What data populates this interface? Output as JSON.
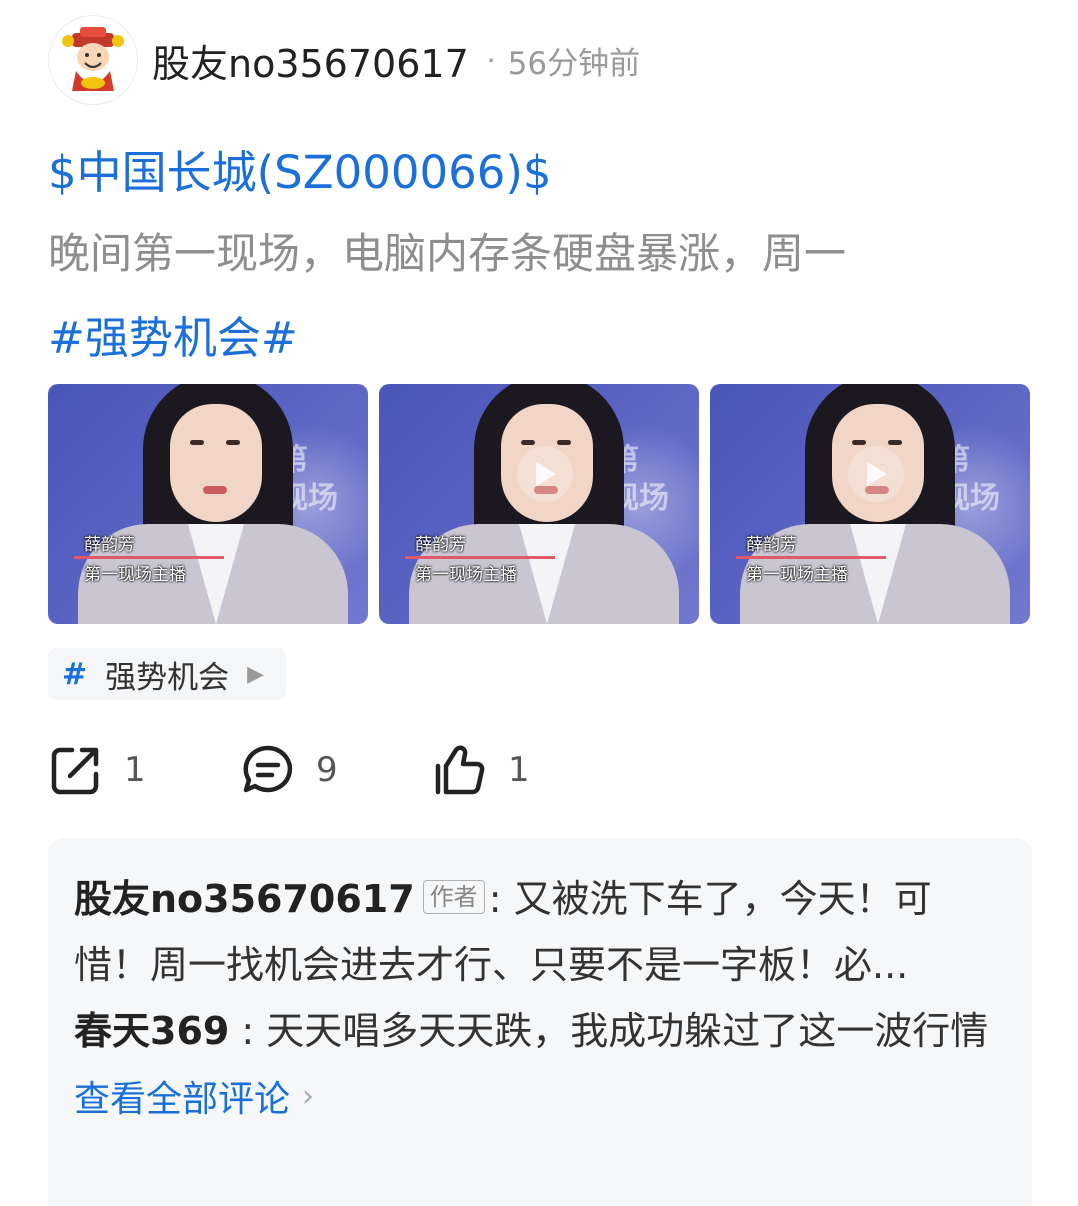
{
  "post": {
    "author": "股友no35670617",
    "separator": "·",
    "time": "56分钟前",
    "stock_link": "$中国长城(SZ000066)$",
    "body": "晚间第一现场，电脑内存条硬盘暴涨，周一",
    "hashtag": "#强势机会#",
    "thumbnails": [
      {
        "brand_line1": "第",
        "brand_line2": "现场",
        "name": "薛韵芳",
        "title": "第一现场主播"
      },
      {
        "brand_line1": "第",
        "brand_line2": "现场",
        "name": "薛韵芳",
        "title": "第一现场主播"
      },
      {
        "brand_line1": "第",
        "brand_line2": "现场",
        "name": "薛韵芳",
        "title": "第一现场主播"
      }
    ],
    "topic_chip": {
      "hash": "#",
      "name": "强势机会",
      "arrow": "▶"
    }
  },
  "actions": {
    "share_count": "1",
    "comment_count": "9",
    "like_count": "1"
  },
  "comments": {
    "items": [
      {
        "user": "股友no35670617",
        "tag": "作者",
        "sep": ":",
        "text": " 又被洗下车了，今天！可惜！周一找机会进去才行、只要不是一字板！必..."
      },
      {
        "user": "春天369",
        "tag": "",
        "sep": " :",
        "text": " 天天唱多天天跌，我成功躲过了这一波行情"
      }
    ],
    "view_all": "查看全部评论",
    "view_all_chevron": "›"
  },
  "colors": {
    "link_blue": "#1b6fd9",
    "muted_gray": "#8e8e8e",
    "panel_bg": "#f6f7f9"
  },
  "icons": [
    "share-icon",
    "comment-icon",
    "thumbs-up-icon",
    "play-icon",
    "avatar-god-of-wealth"
  ]
}
